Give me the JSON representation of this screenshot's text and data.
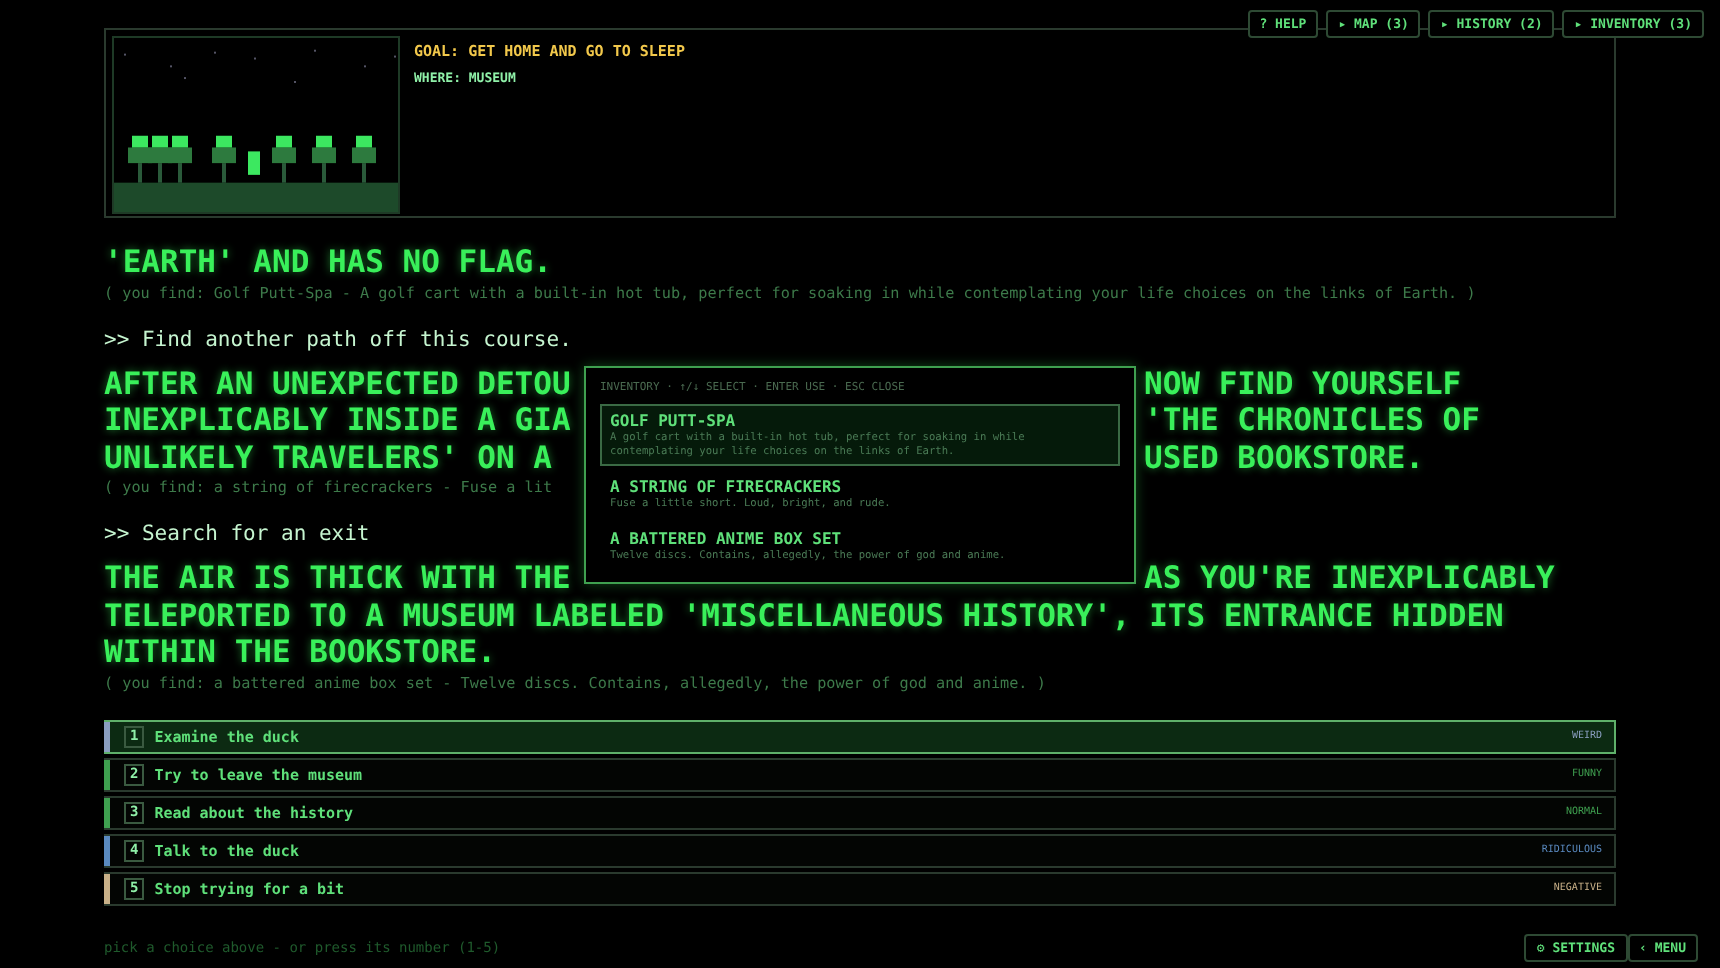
{
  "top_buttons": [
    {
      "label": "? HELP"
    },
    {
      "label": "▸ MAP (3)"
    },
    {
      "label": "▸ HISTORY (2)"
    },
    {
      "label": "▸ INVENTORY (3)"
    }
  ],
  "header": {
    "goal": "GOAL: GET HOME AND GO TO SLEEP",
    "where": "WHERE: MUSEUM"
  },
  "story": [
    {
      "kind": "narration",
      "lines": [
        {
          "left": "'EARTH' AND HAS NO FLAG."
        }
      ]
    },
    {
      "kind": "found",
      "text": "( you find: Golf Putt-Spa - A golf cart with a built-in hot tub, perfect for soaking in while contemplating your life choices on the links of Earth. )"
    },
    {
      "kind": "action",
      "text": ">> Find another path off this course."
    },
    {
      "kind": "narration",
      "lines": [
        {
          "left": "AFTER AN UNEXPECTED DETOU",
          "right": "NOW FIND YOURSELF"
        },
        {
          "left": "INEXPLICABLY INSIDE A GIA",
          "right": "'THE CHRONICLES OF"
        },
        {
          "left": "UNLIKELY TRAVELERS' ON A",
          "right": "USED BOOKSTORE."
        }
      ]
    },
    {
      "kind": "found",
      "text": "( you find: a string of firecrackers - Fuse a lit"
    },
    {
      "kind": "action",
      "text": ">> Search for an exit"
    },
    {
      "kind": "narration",
      "lines": [
        {
          "left": "THE AIR IS THICK WITH THE",
          "right": "AS YOU'RE INEXPLICABLY"
        },
        {
          "left": "TELEPORTED TO A MUSEUM LABELED 'MISCELLANEOUS HISTORY', ITS ENTRANCE HIDDEN"
        },
        {
          "left": "WITHIN THE BOOKSTORE."
        }
      ]
    },
    {
      "kind": "found",
      "text": "( you find: a battered anime box set - Twelve discs. Contains, allegedly, the power of god and anime. )"
    }
  ],
  "choices": [
    {
      "number": "1",
      "label": "Examine the duck",
      "tag": "WEIRD",
      "color": "#8a9ec0",
      "selected": true
    },
    {
      "number": "2",
      "label": "Try to leave the museum",
      "tag": "FUNNY",
      "color": "#3fa050",
      "selected": false
    },
    {
      "number": "3",
      "label": "Read about the history",
      "tag": "NORMAL",
      "color": "#3fa050",
      "selected": false
    },
    {
      "number": "4",
      "label": "Talk to the duck",
      "tag": "RIDICULOUS",
      "color": "#5a8ac0",
      "selected": false
    },
    {
      "number": "5",
      "label": "Stop trying for a bit",
      "tag": "NEGATIVE",
      "color": "#c8b088",
      "selected": false
    }
  ],
  "hint": "pick a choice above - or press its number (1-5)",
  "bottom_buttons": [
    {
      "label": "⚙ SETTINGS"
    },
    {
      "label": "‹ MENU"
    }
  ],
  "inventory": {
    "title": "INVENTORY · ↑/↓ SELECT · ENTER USE · ESC CLOSE",
    "items": [
      {
        "name": "GOLF PUTT-SPA",
        "description": "A golf cart with a built-in hot tub, perfect for soaking in while contemplating your life choices on the links of Earth.",
        "selected": true
      },
      {
        "name": "A STRING OF FIRECRACKERS",
        "description": "Fuse a little short. Loud, bright, and rude.",
        "selected": false
      },
      {
        "name": "A BATTERED ANIME BOX SET",
        "description": "Twelve discs. Contains, allegedly, the power of god and anime.",
        "selected": false
      }
    ]
  }
}
